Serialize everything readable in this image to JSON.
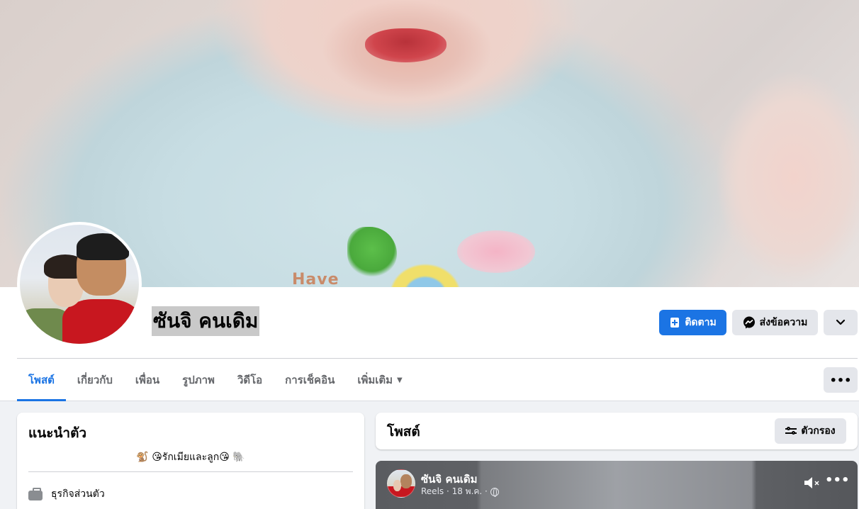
{
  "profile": {
    "name": "ซันจิ คนเดิม",
    "follow_label": "ติดตาม",
    "message_label": "ส่งข้อความ"
  },
  "cover": {
    "shirt_text": "Have"
  },
  "tabs": [
    {
      "label": "โพสต์",
      "active": true
    },
    {
      "label": "เกี่ยวกับ"
    },
    {
      "label": "เพื่อน"
    },
    {
      "label": "รูปภาพ"
    },
    {
      "label": "วิดีโอ"
    },
    {
      "label": "การเช็คอิน"
    },
    {
      "label": "เพิ่มเติม"
    }
  ],
  "intro": {
    "title": "แนะนำตัว",
    "bio": "🐒 😘รักเมียและลูก😘 🐘",
    "work": "ธุรกิจส่วนตัว"
  },
  "posts": {
    "title": "โพสต์",
    "filter_label": "ตัวกรอง"
  },
  "reel": {
    "author": "ซันจิ คนเดิม",
    "meta": "Reels · 18 พ.ค. ·"
  },
  "colors": {
    "accent": "#1b74e4",
    "button_gray": "#e4e6eb",
    "page_bg": "#f0f2f5"
  },
  "icons": {
    "follow": "add-friend-icon",
    "message": "messenger-icon",
    "more": "chevron-down-icon",
    "tab_more": "ellipsis-icon",
    "filter": "filter-sliders-icon",
    "work": "briefcase-icon",
    "privacy": "globe-icon",
    "sound": "mute-icon"
  }
}
